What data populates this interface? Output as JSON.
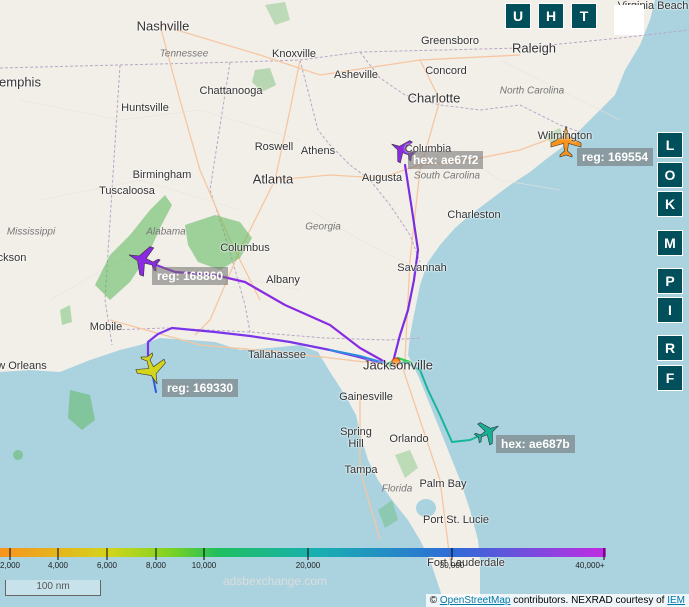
{
  "map": {
    "states": [
      "Tennessee",
      "Alabama",
      "Georgia",
      "Mississippi",
      "South Carolina",
      "North Carolina",
      "Florida"
    ],
    "cities": [
      "Nashville",
      "Knoxville",
      "Greensboro",
      "Raleigh",
      "Virginia Beach",
      "emphis",
      "Chattanooga",
      "Asheville",
      "Concord",
      "Charlotte",
      "Huntsville",
      "Roswell",
      "Athens",
      "Columbia",
      "Wilmington",
      "Birmingham",
      "Atlanta",
      "Augusta",
      "Tuscaloosa",
      "Columbus",
      "Charleston",
      "ckson",
      "Savannah",
      "Albany",
      "Mobile",
      "Tallahassee",
      "Jacksonville",
      "w Orleans",
      "Gainesville",
      "Spring Hill",
      "Orlando",
      "Tampa",
      "Palm Bay",
      "Port St. Lucie",
      "Fort Lauderdale"
    ]
  },
  "aircraft": [
    {
      "label": "hex: ae67f2",
      "color": "#8a2be2"
    },
    {
      "label": "reg: 169554",
      "color": "#f7941d"
    },
    {
      "label": "reg: 168860",
      "color": "#8a2be2"
    },
    {
      "label": "reg: 169330",
      "color": "#d4d41c"
    },
    {
      "label": "hex: ae687b",
      "color": "#18b094"
    }
  ],
  "top_buttons": [
    "U",
    "H",
    "T"
  ],
  "side_buttons": [
    "L",
    "O",
    "K",
    "M",
    "P",
    "I",
    "R",
    "F"
  ],
  "legend": {
    "ticks": [
      "2,000",
      "4,000",
      "6,000",
      "8,000",
      "10,000",
      "20,000",
      "30,000",
      "40,000+"
    ]
  },
  "scale_bar": "100 nm",
  "watermark": "adsbexchange.com",
  "attribution": {
    "prefix": "©",
    "osm": "OpenStreetMap",
    "middle": "contributors. NEXRAD courtesy of",
    "iem": "IEM"
  }
}
